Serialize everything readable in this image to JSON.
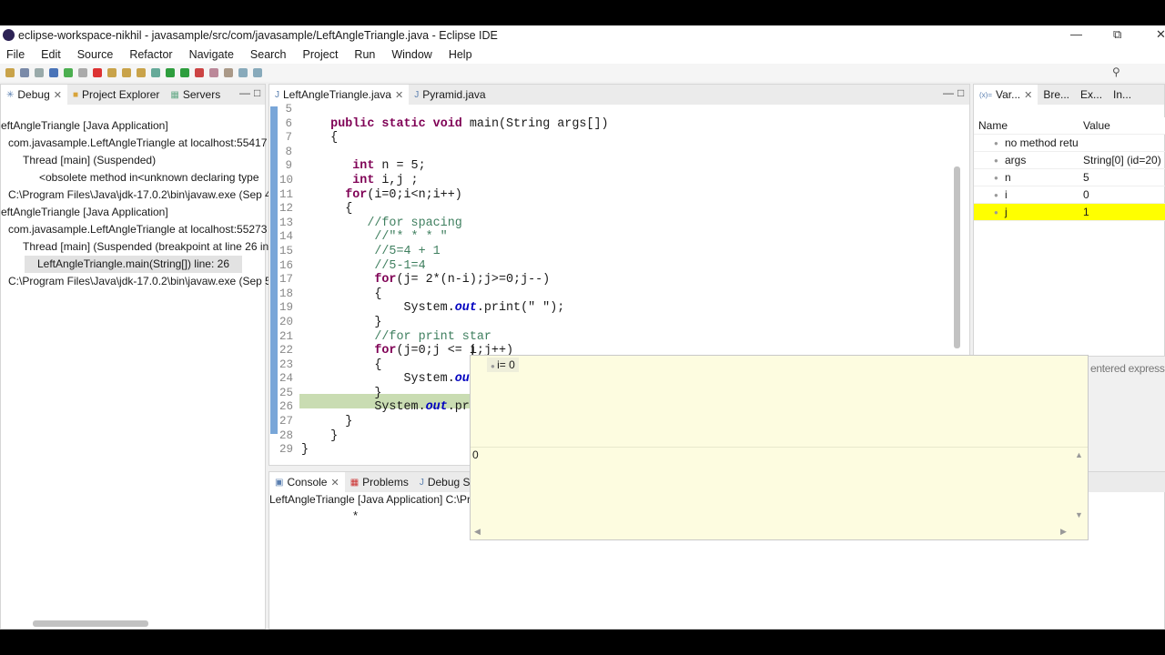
{
  "window": {
    "title": "eclipse-workspace-nikhil - javasample/src/com/javasample/LeftAngleTriangle.java - Eclipse IDE"
  },
  "menu": [
    "File",
    "Edit",
    "Source",
    "Refactor",
    "Navigate",
    "Search",
    "Project",
    "Run",
    "Window",
    "Help"
  ],
  "left_panel": {
    "tabs": [
      "Debug",
      "Project Explorer",
      "Servers"
    ],
    "tree": [
      "eftAngleTriangle [Java Application]",
      "com.javasample.LeftAngleTriangle at localhost:55417",
      "Thread [main] (Suspended)",
      "<obsolete method in<unknown declaring type",
      "C:\\Program Files\\Java\\jdk-17.0.2\\bin\\javaw.exe (Sep 4",
      "eftAngleTriangle [Java Application]",
      "com.javasample.LeftAngleTriangle at localhost:55273",
      "Thread [main] (Suspended (breakpoint at line 26 in",
      "LeftAngleTriangle.main(String[]) line: 26",
      "C:\\Program Files\\Java\\jdk-17.0.2\\bin\\javaw.exe (Sep 5"
    ]
  },
  "editor": {
    "tabs": [
      "LeftAngleTriangle.java",
      "Pyramid.java"
    ],
    "line_numbers": [
      "5",
      "6",
      "7",
      "8",
      "9",
      "10",
      "11",
      "12",
      "13",
      "14",
      "15",
      "16",
      "17",
      "18",
      "19",
      "20",
      "21",
      "22",
      "23",
      "24",
      "25",
      "26",
      "27",
      "28",
      "29"
    ],
    "current_line": "26"
  },
  "hover": {
    "variable": "i= 0",
    "value": "0"
  },
  "right_panel": {
    "tabs": [
      "Var...",
      "Bre...",
      "Ex...",
      "In..."
    ],
    "columns": [
      "Name",
      "Value"
    ],
    "rows": [
      {
        "name": "no method retu",
        "value": ""
      },
      {
        "name": "args",
        "value": "String[0]  (id=20)"
      },
      {
        "name": "n",
        "value": "5"
      },
      {
        "name": "i",
        "value": "0"
      },
      {
        "name": "j",
        "value": "1"
      }
    ],
    "hint": "entered expressi",
    "highlight_color": "#ffff00"
  },
  "console": {
    "tabs": [
      "Console",
      "Problems",
      "Debug She"
    ],
    "header": "LeftAngleTriangle [Java Application] C:\\Pr",
    "output": "*"
  }
}
